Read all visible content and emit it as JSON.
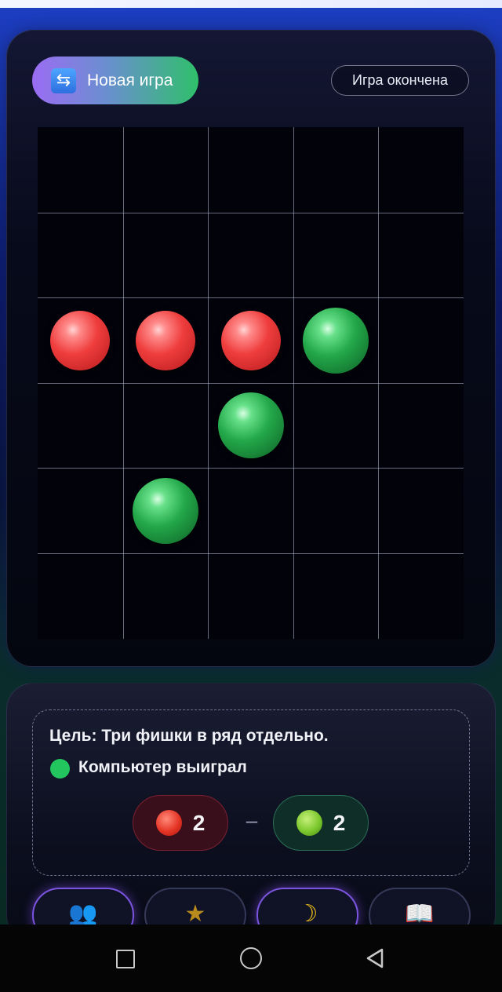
{
  "header": {
    "new_game_label": "Новая игра",
    "new_game_icon": "refresh-arrows-icon",
    "status": "Игра окончена"
  },
  "board": {
    "columns": 5,
    "rows": 6,
    "pieces": [
      {
        "row": 3,
        "col": 1,
        "color": "red"
      },
      {
        "row": 3,
        "col": 2,
        "color": "red"
      },
      {
        "row": 3,
        "col": 3,
        "color": "red"
      },
      {
        "row": 3,
        "col": 4,
        "color": "green"
      },
      {
        "row": 4,
        "col": 3,
        "color": "green"
      },
      {
        "row": 5,
        "col": 2,
        "color": "green"
      }
    ]
  },
  "info": {
    "goal": "Цель: Три фишки в ряд отдельно.",
    "result": "Компьютер выиграл",
    "result_color": "#22c55e",
    "score": {
      "red": "2",
      "green": "2",
      "separator": "–"
    }
  },
  "tabs": [
    {
      "icon": "two-players-icon",
      "glyph": "👥",
      "active": true
    },
    {
      "icon": "star-icon",
      "glyph": "★",
      "active": false
    },
    {
      "icon": "moon-icon",
      "glyph": "☽",
      "active": true
    },
    {
      "icon": "book-icon",
      "glyph": "📖",
      "active": false
    }
  ],
  "colors": {
    "red_piece": "#ef3d3d",
    "green_piece": "#23a84a",
    "accent_purple": "#7b54e0"
  }
}
